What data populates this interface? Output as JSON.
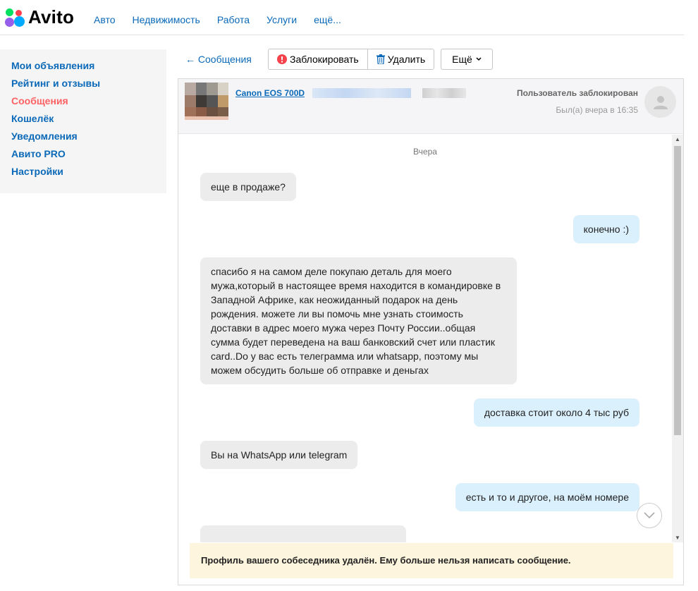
{
  "brand": {
    "logo_text": "Avito",
    "accent": "#0a69b8",
    "active_color": "#ff6163"
  },
  "topnav": [
    "Авто",
    "Недвижимость",
    "Работа",
    "Услуги",
    "ещё..."
  ],
  "sidebar": {
    "items": [
      {
        "label": "Мои объявления",
        "active": false
      },
      {
        "label": "Рейтинг и отзывы",
        "active": false
      },
      {
        "label": "Сообщения",
        "active": true
      },
      {
        "label": "Кошелёк",
        "active": false
      },
      {
        "label": "Уведомления",
        "active": false
      },
      {
        "label": "Авито PRO",
        "active": false
      },
      {
        "label": "Настройки",
        "active": false
      }
    ]
  },
  "toolbar": {
    "back_label": "← Сообщения",
    "block_label": "Заблокировать",
    "delete_label": "Удалить",
    "more_label": "Ещё"
  },
  "chat": {
    "item_title": "Canon EOS 700D",
    "status": "Пользователь заблокирован",
    "last_seen": "Был(а) вчера в 16:35",
    "date_separator": "Вчера",
    "messages": [
      {
        "direction": "in",
        "text": "еще в продаже?"
      },
      {
        "direction": "out",
        "text": "конечно :)"
      },
      {
        "direction": "in",
        "text": "спасибо я на самом деле покупаю деталь для моего мужа,который в настоящее время находится в командировке в Западной Африке, как неожиданный подарок на день рождения. можете ли вы помочь мне узнать стоимость доставки в адрес моего мужа через Почту России..общая сумма будет переведена на ваш банковский счет или пластик card..Do у вас есть телеграмма или whatsapp, поэтому мы можем обсудить больше об отправке и деньгах"
      },
      {
        "direction": "out",
        "text": "доставка стоит около 4 тыс руб"
      },
      {
        "direction": "in",
        "text": "Вы на WhatsApp или telegram"
      },
      {
        "direction": "out",
        "text": "есть и то и другое, на моём номере"
      }
    ],
    "notice": "Профиль вашего собеседника удалён. Ему больше нельзя написать сообщение."
  }
}
